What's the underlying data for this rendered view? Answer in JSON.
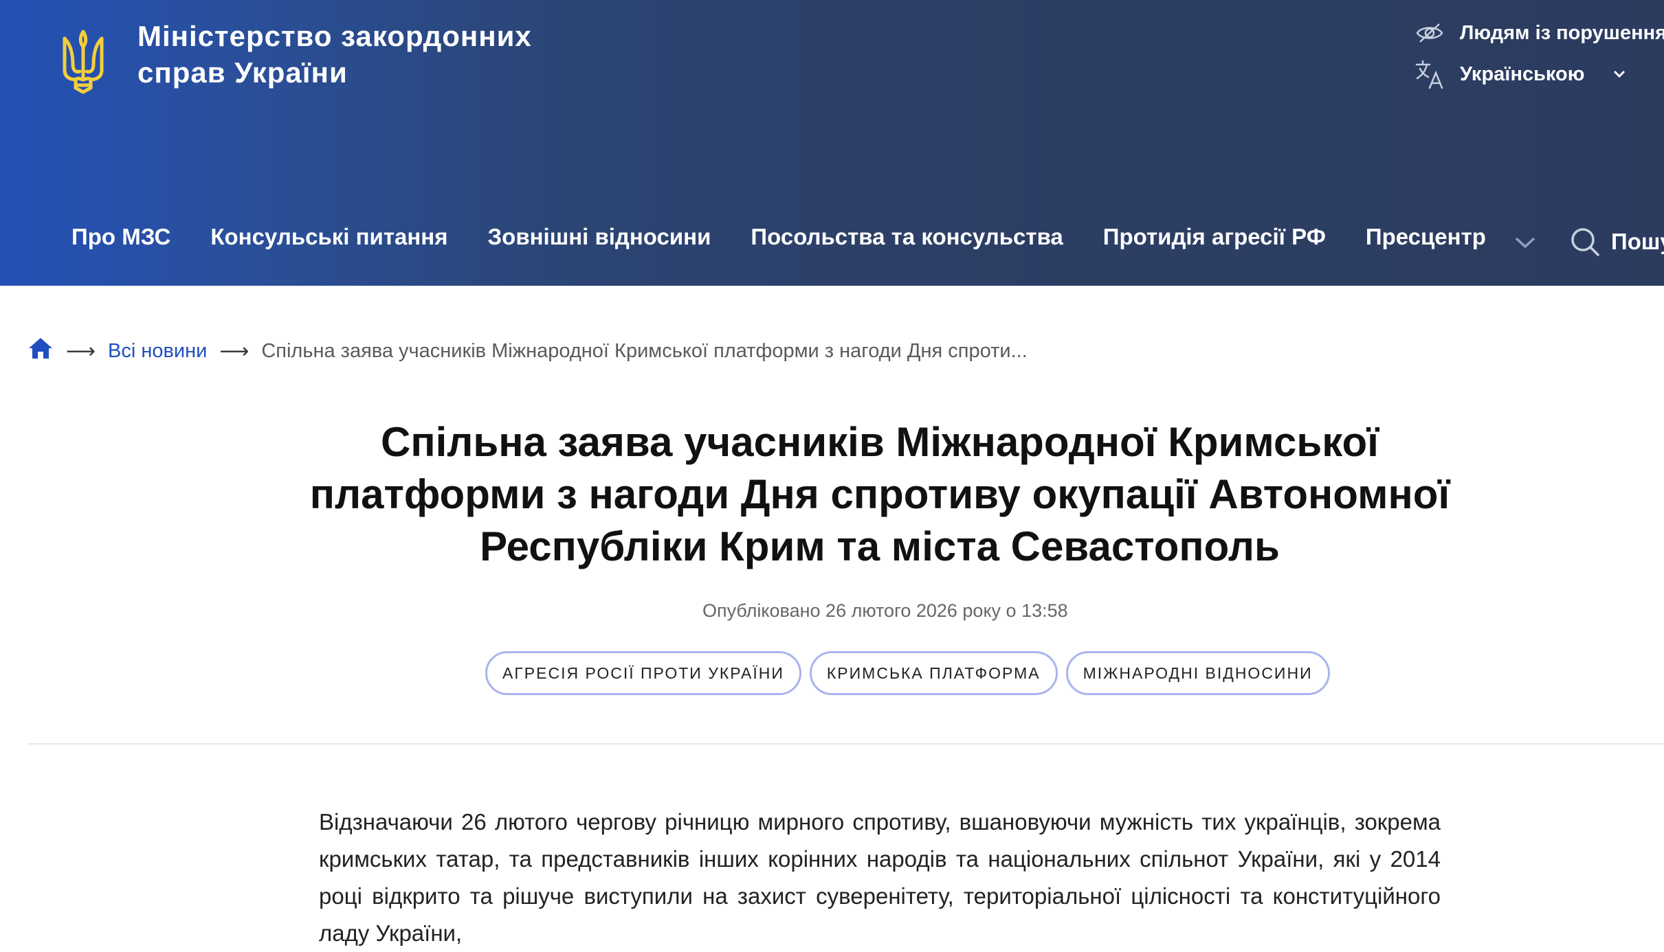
{
  "header": {
    "site_title_line1": "Міністерство закордонних",
    "site_title_line2": "справ України",
    "accessibility_label": "Людям із порушенням",
    "language_label": "Українською",
    "search_label": "Пошу"
  },
  "nav": {
    "items": [
      {
        "label": "Про МЗС"
      },
      {
        "label": "Консульські питання"
      },
      {
        "label": "Зовнішні відносини"
      },
      {
        "label": "Посольства та консульства"
      },
      {
        "label": "Протидія агресії РФ"
      },
      {
        "label": "Пресцентр"
      }
    ]
  },
  "breadcrumb": {
    "arrow": "⟶",
    "all_news": "Всі новини",
    "current": "Спільна заява учасників Міжнародної Кримської платформи з нагоди Дня спроти..."
  },
  "article": {
    "title": "Спільна заява учасників Міжнародної Кримської платформи з нагоди Дня спротиву окупації Автономної Республіки Крим та міста Севастополь",
    "published": "Опубліковано 26 лютого 2026 року о 13:58",
    "tags": [
      {
        "label": "АГРЕСІЯ РОСІЇ ПРОТИ УКРАЇНИ"
      },
      {
        "label": "КРИМСЬКА ПЛАТФОРМА"
      },
      {
        "label": "МІЖНАРОДНІ ВІДНОСИНИ"
      }
    ],
    "body": "Відзначаючи 26 лютого чергову річницю мирного спротиву, вшановуючи мужність тих українців, зокрема кримських татар, та представників інших корінних народів та національних спільнот України, які у 2014 році відкрито та рішуче виступили на захист суверенітету, територіальної цілісності та конституційного ладу України,"
  },
  "colors": {
    "header_gradient_start": "#2350b6",
    "header_gradient_end": "#2b3c5f",
    "link": "#1f4fbf",
    "tag_border": "#a9b4ee",
    "trident": "#f2cf3d"
  },
  "icons": [
    "trident-logo-icon",
    "accessibility-eye-icon",
    "translate-icon",
    "chevron-down-icon",
    "search-icon",
    "home-icon"
  ]
}
